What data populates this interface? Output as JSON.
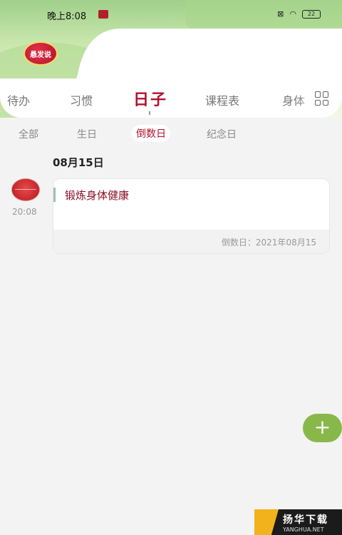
{
  "status_bar": {
    "time": "晚上8:08",
    "battery": "22"
  },
  "logo": {
    "text": "悬发说"
  },
  "top_tabs": [
    {
      "label": "待办"
    },
    {
      "label": "习惯"
    },
    {
      "label": "日子"
    },
    {
      "label": "课程表"
    },
    {
      "label": "身体"
    }
  ],
  "sub_tabs": [
    {
      "label": "全部"
    },
    {
      "label": "生日"
    },
    {
      "label": "倒数日"
    },
    {
      "label": "纪念日"
    }
  ],
  "date_heading": "08月15日",
  "event": {
    "time": "20:08",
    "title": "锻炼身体健康",
    "countdown": "倒数日：2021年08月15"
  },
  "fab": {
    "label": "+"
  },
  "watermark": {
    "cn": "扬华下载",
    "en": "YANGHUA.NET"
  },
  "colors": {
    "accent": "#b1122d",
    "fab": "#89b84a"
  }
}
